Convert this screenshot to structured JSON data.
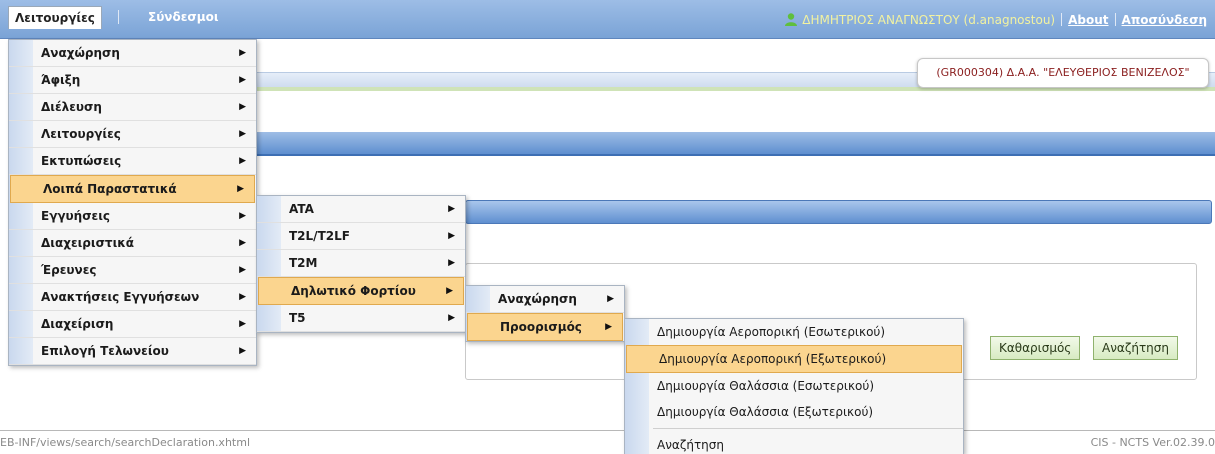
{
  "menubar": {
    "items": [
      {
        "label": "Λειτουργίες"
      },
      {
        "label": "Σύνδεσμοι"
      }
    ],
    "user": "ΔΗΜΗΤΡΙΟΣ ΑΝΑΓΝΩΣΤΟΥ (d.anagnostou)",
    "about_label": "About",
    "logout_label": "Αποσύνδεση"
  },
  "office": "(GR000304) Δ.Α.Α. \"ΕΛΕΥΘΕΡΙΟΣ ΒΕΝΙΖΕΛΟΣ\"",
  "buttons": {
    "clear": "Καθαρισμός",
    "search": "Αναζήτηση"
  },
  "footer": {
    "path": "EB-INF/views/search/searchDeclaration.xhtml",
    "version": "CIS - NCTS Ver.02.39.0"
  },
  "menu1": {
    "items": [
      {
        "label": "Αναχώρηση"
      },
      {
        "label": "Άφιξη"
      },
      {
        "label": "Διέλευση"
      },
      {
        "label": "Λειτουργίες"
      },
      {
        "label": "Εκτυπώσεις"
      },
      {
        "label": "Λοιπά Παραστατικά"
      },
      {
        "label": "Εγγυήσεις"
      },
      {
        "label": "Διαχειριστικά"
      },
      {
        "label": "Έρευνες"
      },
      {
        "label": "Ανακτήσεις Εγγυήσεων"
      },
      {
        "label": "Διαχείριση"
      },
      {
        "label": "Επιλογή Τελωνείου"
      }
    ]
  },
  "menu2": {
    "items": [
      {
        "label": "ATA"
      },
      {
        "label": "T2L/T2LF"
      },
      {
        "label": "T2M"
      },
      {
        "label": "Δηλωτικό Φορτίου"
      },
      {
        "label": "T5"
      }
    ]
  },
  "menu3": {
    "items": [
      {
        "label": "Αναχώρηση"
      },
      {
        "label": "Προορισμός"
      }
    ]
  },
  "menu4": {
    "items": [
      {
        "label": "Δημιουργία Αεροπορική (Εσωτερικού)"
      },
      {
        "label": "Δημιουργία Αεροπορική (Εξωτερικού)"
      },
      {
        "label": "Δημιουργία Θαλάσσια (Εσωτερικού)"
      },
      {
        "label": "Δημιουργία Θαλάσσια (Εξωτερικού)"
      },
      {
        "label": "Αναζήτηση"
      }
    ]
  },
  "colors": {
    "highlight": "#fbd58f",
    "menubar": "#7aa3d6",
    "office_text": "#8a1e1e"
  }
}
